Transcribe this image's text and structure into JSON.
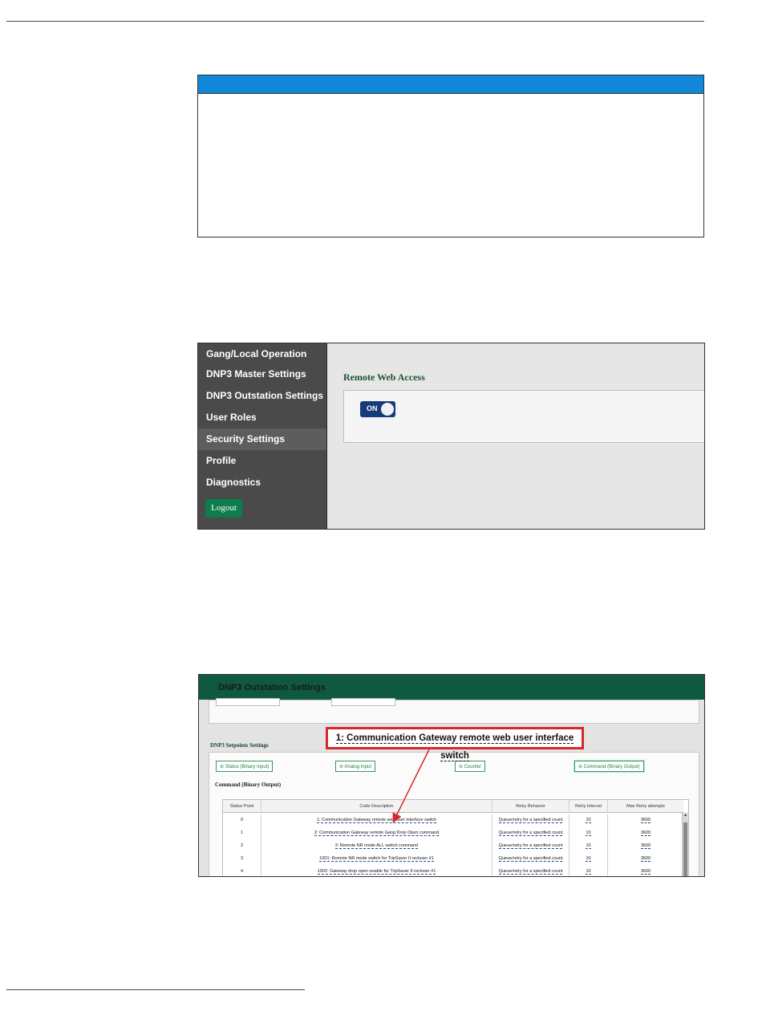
{
  "screenshot1": {
    "sidebar": {
      "items": [
        {
          "label": "Gang/Local Operation"
        },
        {
          "label": "DNP3 Master Settings"
        },
        {
          "label": "DNP3 Outstation Settings"
        },
        {
          "label": "User Roles"
        },
        {
          "label": "Security Settings",
          "active": true
        },
        {
          "label": "Profile"
        },
        {
          "label": "Diagnostics"
        }
      ],
      "logout_label": "Logout"
    },
    "section_title": "Remote Web Access",
    "toggle_label": "ON",
    "toggle_state": "on"
  },
  "screenshot2": {
    "header_title": "DNP3 Outstation Settings",
    "section_title": "DNP3 Setpoints Settings",
    "tabs": [
      {
        "label": "⊖ Status (Binary Input)"
      },
      {
        "label": "⊖ Analog Input"
      },
      {
        "label": "⊖ Counter"
      },
      {
        "label": "⊖ Command (Binary Output)",
        "active": true
      }
    ],
    "subsection_title": "Command (Binary Output)",
    "table": {
      "headers": [
        "Status Point",
        "Code Description",
        "Retry Behavior",
        "Retry Interval",
        "Max Retry attempts"
      ],
      "rows": [
        [
          "0",
          "1: Communication Gateway remote web user interface switch",
          "Queue/retry for a specified count",
          "10",
          "3600"
        ],
        [
          "1",
          "2: Communication Gateway remote Gang Drop Open command",
          "Queue/retry for a specified count",
          "10",
          "3600"
        ],
        [
          "2",
          "3: Remote NR mode ALL switch command",
          "Queue/retry for a specified count",
          "10",
          "3600"
        ],
        [
          "3",
          "1001: Remote NR mode switch for TripSaver II recloser #1",
          "Queue/retry for a specified count",
          "10",
          "3600"
        ],
        [
          "4",
          "1002: Gateway drop open enable for TripSaver II recloser #1",
          "Queue/retry for a specified count",
          "10",
          "3600"
        ]
      ]
    },
    "callout_text": "1: Communication Gateway remote web user interface switch",
    "colors": {
      "callout_border": "#d9262a",
      "header_bg": "#0f5a3f",
      "arrow": "#d9262a"
    }
  },
  "colors": {
    "note_header": "#1287d8",
    "sidebar_bg": "#4a4a4a",
    "logout_bg": "#0e7d4b",
    "toggle_bg": "#173b7a"
  }
}
